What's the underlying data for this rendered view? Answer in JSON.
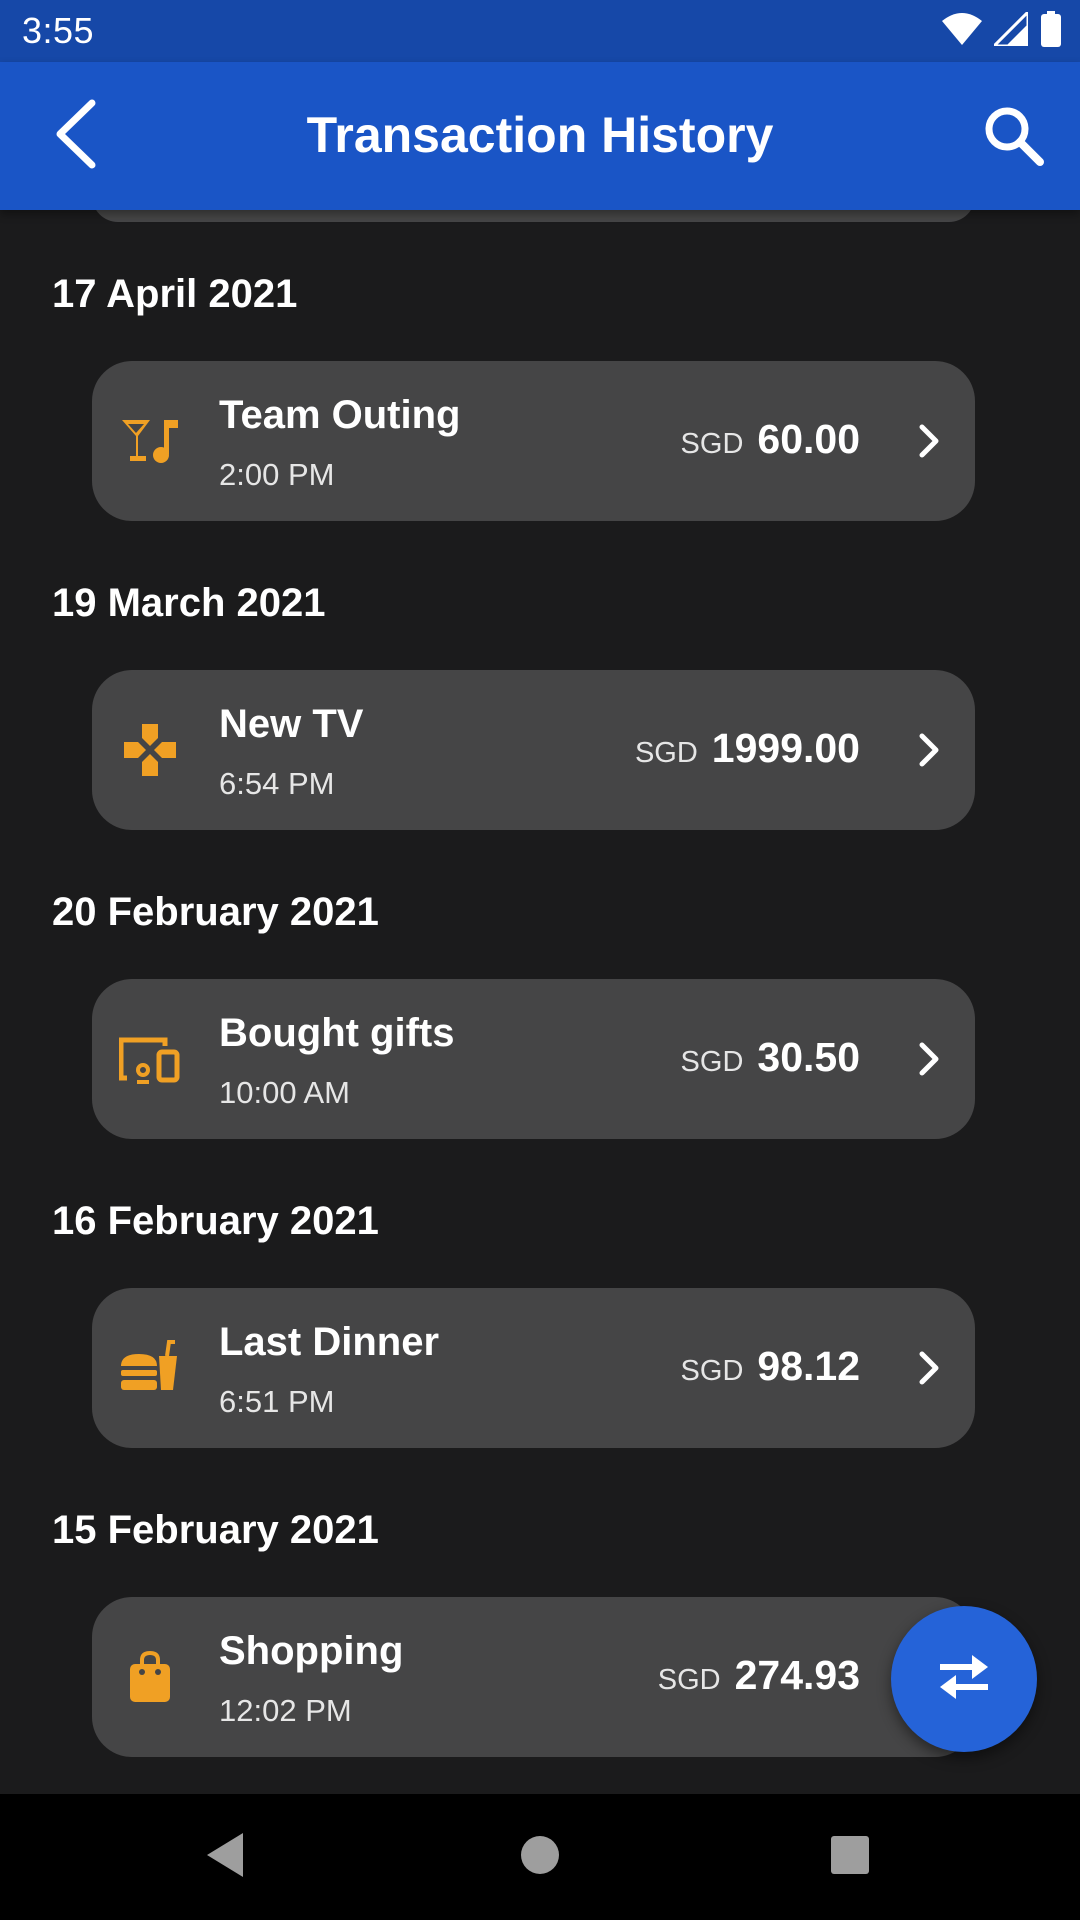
{
  "status_bar": {
    "time": "3:55",
    "icons": [
      "wifi-icon",
      "signal-icon",
      "battery-icon"
    ]
  },
  "app_bar": {
    "title": "Transaction History",
    "back_icon": "back-arrow-icon",
    "search_icon": "search-icon"
  },
  "groups": [
    {
      "date": "17 April 2021",
      "transaction": {
        "title": "Team Outing",
        "time": "2:00 PM",
        "currency": "SGD",
        "amount": "60.00",
        "icon": "nightlife-icon"
      }
    },
    {
      "date": "19 March 2021",
      "transaction": {
        "title": "New TV",
        "time": "6:54 PM",
        "currency": "SGD",
        "amount": "1999.00",
        "icon": "gamepad-icon"
      }
    },
    {
      "date": "20 February 2021",
      "transaction": {
        "title": "Bought gifts",
        "time": "10:00 AM",
        "currency": "SGD",
        "amount": "30.50",
        "icon": "devices-icon"
      }
    },
    {
      "date": "16 February 2021",
      "transaction": {
        "title": "Last Dinner",
        "time": "6:51 PM",
        "currency": "SGD",
        "amount": "98.12",
        "icon": "fastfood-icon"
      }
    },
    {
      "date": "15 February 2021",
      "transaction": {
        "title": "Shopping",
        "time": "12:02 PM",
        "currency": "SGD",
        "amount": "274.93",
        "icon": "shopping-bag-icon"
      }
    }
  ],
  "fab": {
    "icon": "swap-horiz-icon"
  },
  "nav_bar": {
    "icons": [
      "nav-back-icon",
      "nav-home-icon",
      "nav-recents-icon"
    ]
  },
  "colors": {
    "status_bar": "#1648a8",
    "app_bar": "#1a55c6",
    "background": "#1b1b1c",
    "card": "#454546",
    "accent_icon": "#f0a024",
    "fab": "#2563d8"
  }
}
